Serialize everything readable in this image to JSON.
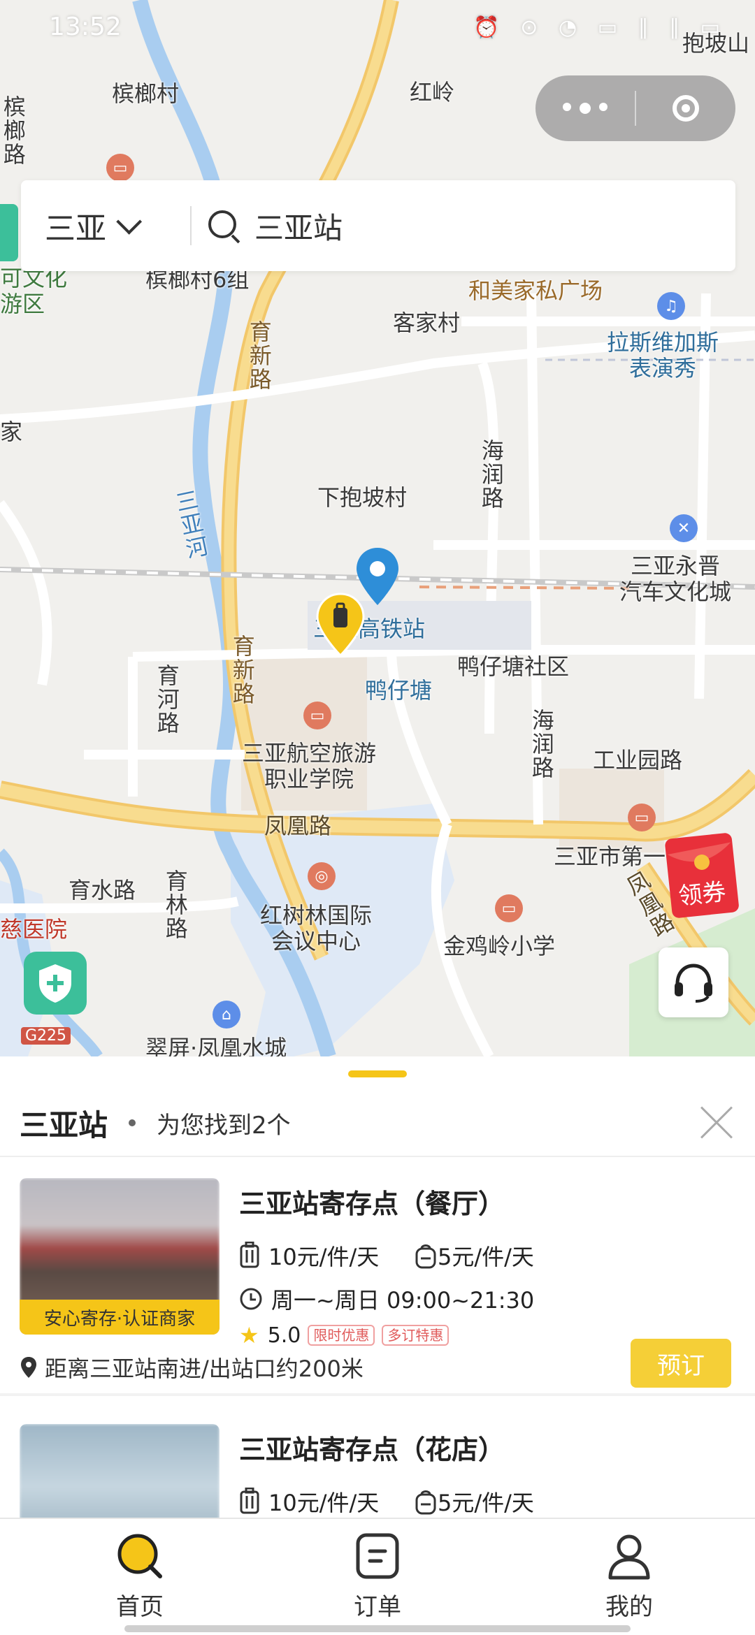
{
  "status_bar": {
    "time": "13:52",
    "icons": "⏰ ⊙ ◔ ▭ ∥ ∥ ▭"
  },
  "map": {
    "labels": {
      "binglangcun": "槟榔村",
      "hongling": "红岭",
      "baopo": "抱坡山",
      "binglanglu": "槟榔路",
      "culture_left": "可文化\n游区",
      "binglang6": "槟榔村6组",
      "hemei": "和美家私广场",
      "kejiacun": "客家村",
      "lasvegas": "拉斯维加斯\n表演秀",
      "yuxinlu1": "育新路",
      "jia": "家",
      "sanyahe": "三亚河",
      "haerunlu1": "海润路",
      "xiabaopo": "下抱坡村",
      "yongjin": "三亚永晋\n汽车文化城",
      "station": "三亚高铁站",
      "yazaitang_community": "鸭仔塘社区",
      "yazaitang": "鸭仔塘",
      "yuhelu": "育河路",
      "yuxinlu2": "育新路",
      "college": "三亚航空旅游\n职业学院",
      "haerunlu2": "海润路",
      "gongyeyuan": "工业园路",
      "fenghuanglu": "凤凰路",
      "sanya_no1": "三亚市第一",
      "fenghuanglu2": "凤凰路",
      "yushuilu": "育水路",
      "yulinlu": "育林路",
      "hongshulin": "红树林国际\n会议中心",
      "jinjiling": "金鸡岭小学",
      "hospital": "慈医院",
      "g225": "G225",
      "cuiping": "翠屏·凤凰水城"
    },
    "coupon_label": "领券"
  },
  "search": {
    "city": "三亚",
    "query": "三亚站"
  },
  "panel": {
    "station": "三亚站",
    "result_text": "为您找到2个",
    "stores": [
      {
        "name": "三亚站寄存点（餐厅）",
        "price_large": "10元/件/天",
        "price_small": "5元/件/天",
        "hours": "周一~周日 09:00~21:30",
        "rating": "5.0",
        "tags": [
          "限时优惠",
          "多订特惠"
        ],
        "badge": "安心寄存·认证商家",
        "distance": "距离三亚站南进/出站口约200米",
        "book": "预订"
      },
      {
        "name": "三亚站寄存点（花店）",
        "price_large": "10元/件/天",
        "price_small": "5元/件/天"
      }
    ]
  },
  "tabs": [
    {
      "label": "首页",
      "icon": "home-search-icon"
    },
    {
      "label": "订单",
      "icon": "order-icon"
    },
    {
      "label": "我的",
      "icon": "profile-icon"
    }
  ],
  "colors": {
    "accent": "#f5c518",
    "book": "#f5cf37",
    "shield": "#3cbf9a",
    "coupon": "#e8303a"
  }
}
